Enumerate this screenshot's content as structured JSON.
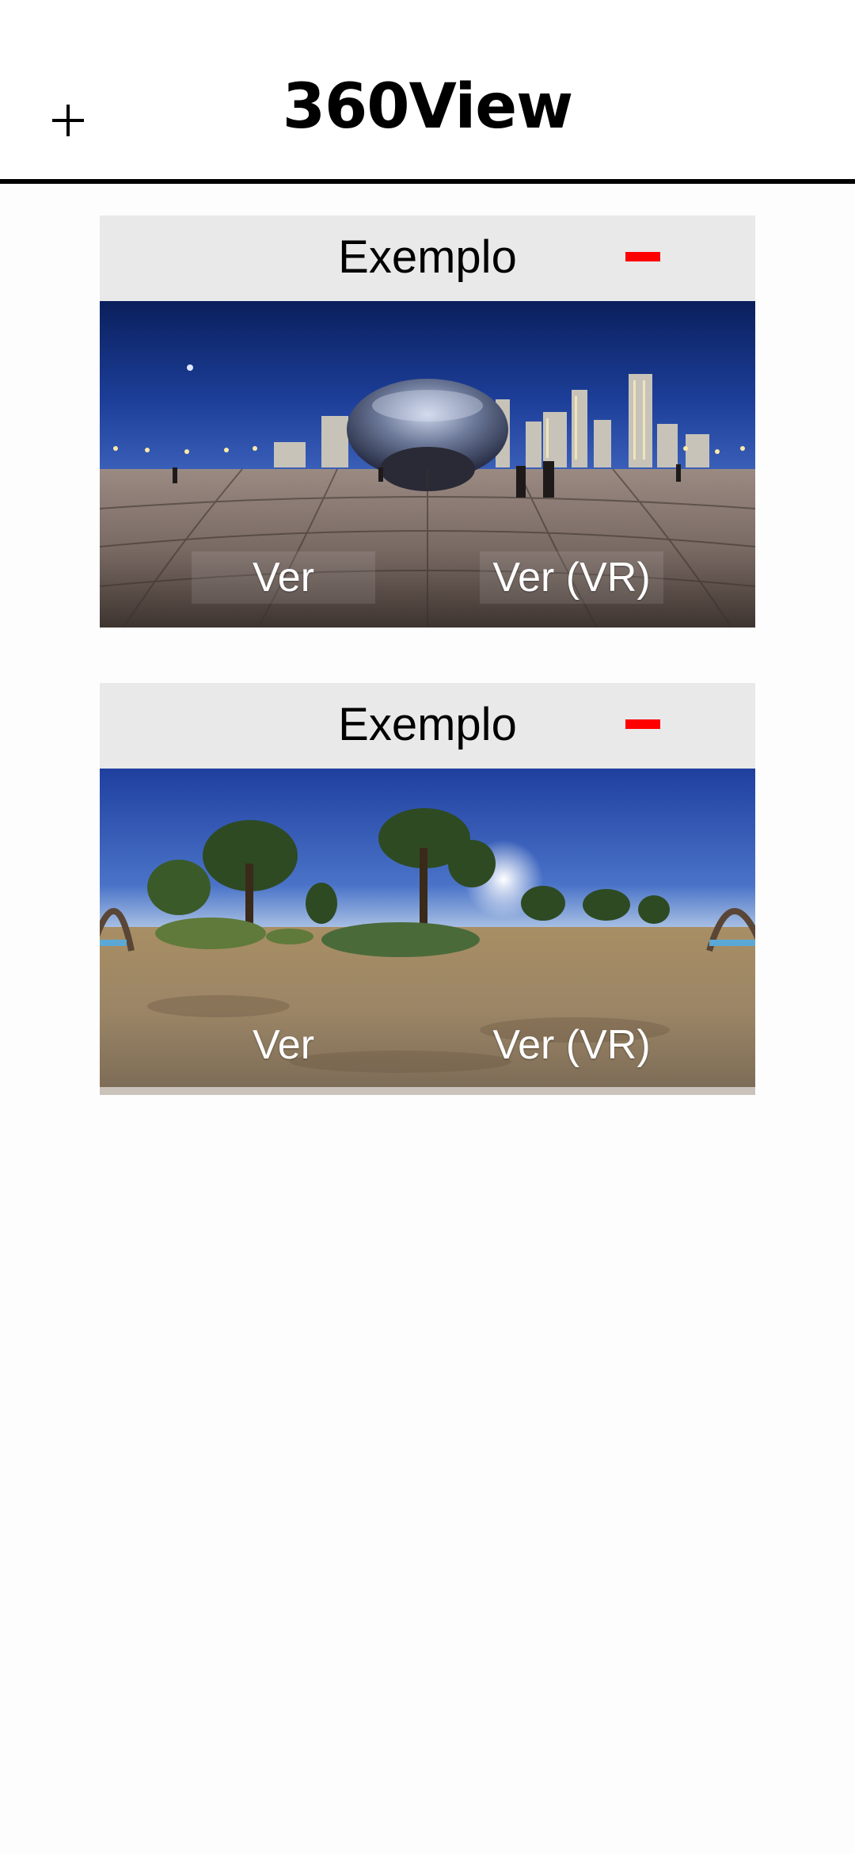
{
  "header": {
    "title": "360View",
    "add_icon": "plus-icon"
  },
  "panoramas": [
    {
      "title": "Exemplo",
      "remove_icon": "minus-icon",
      "scene": "night city plaza with reflective sculpture",
      "view_label": "Ver",
      "view_vr_label": "Ver (VR)"
    },
    {
      "title": "Exemplo",
      "remove_icon": "minus-icon",
      "scene": "park with trees under blue sky",
      "view_label": "Ver",
      "view_vr_label": "Ver (VR)"
    }
  ],
  "colors": {
    "accent_remove": "#ff0000",
    "card_header_bg": "#e9e9e9",
    "header_border": "#000000"
  }
}
